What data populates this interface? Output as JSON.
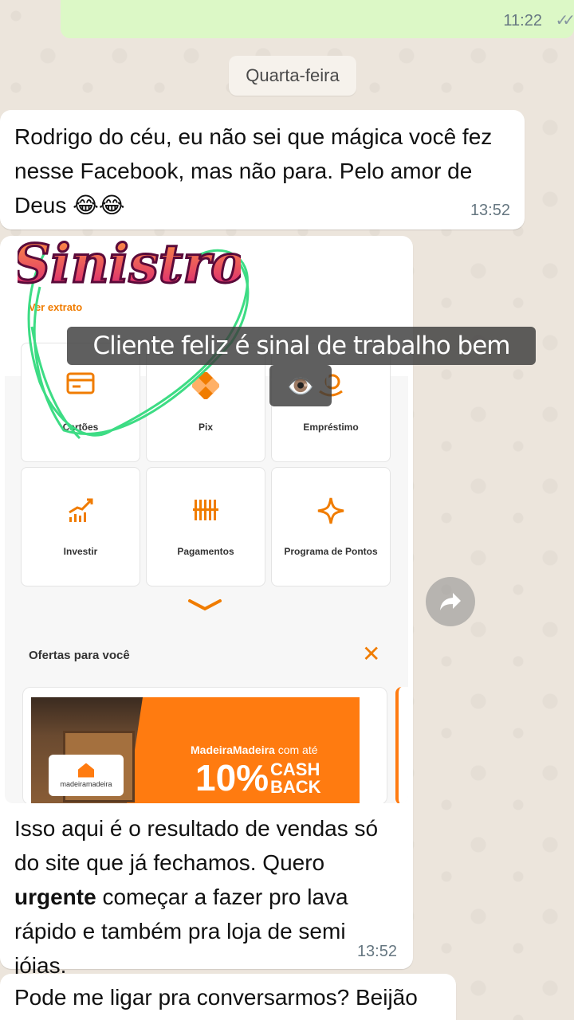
{
  "top_message": {
    "time": "11:22",
    "status": "read-double-check-icon"
  },
  "date_separator": "Quarta-feira",
  "message1": {
    "text": "Rodrigo do céu, eu não sei que mágica você fez nesse Facebook, mas não para. Pelo amor de Deus 😂😂",
    "time": "13:52"
  },
  "image_message": {
    "screenshot": {
      "ver_extrato": "Ver extrato",
      "tiles": [
        {
          "label": "Cartões",
          "icon": "card-icon"
        },
        {
          "label": "Pix",
          "icon": "pix-icon"
        },
        {
          "label": "Empréstimo",
          "icon": "loan-icon"
        },
        {
          "label": "Investir",
          "icon": "invest-chart-icon"
        },
        {
          "label": "Pagamentos",
          "icon": "barcode-icon"
        },
        {
          "label": "Programa de Pontos",
          "icon": "sparkle-icon"
        }
      ],
      "offers_title": "Ofertas para você",
      "banner": {
        "brand": "MadeiraMadeira",
        "brand_suffix": "com até",
        "percent": "10%",
        "cashback": "CASH BACK",
        "logo_text": "madeiramadeira"
      }
    },
    "caption_pre": "Isso aqui é o resultado de vendas só do site que já fechamos. Quero ",
    "caption_bold": "urgente",
    "caption_post": " começar a fazer pro lava rápido e também pra loja de semi jóias.",
    "time": "13:52"
  },
  "message3": {
    "text": "Pode me ligar pra conversarmos? Beijão"
  },
  "overlay": {
    "sticker": "Sinistro",
    "caption": "Cliente feliz é sinal de trabalho bem feito!",
    "eye_emoji": "👁️"
  },
  "colors": {
    "accent": "#f07c00",
    "outgoing": "#dcf8c6",
    "scribble": "#3ddc84",
    "sticker_top": "#ff9a3c",
    "sticker_bottom": "#d81b7a"
  }
}
